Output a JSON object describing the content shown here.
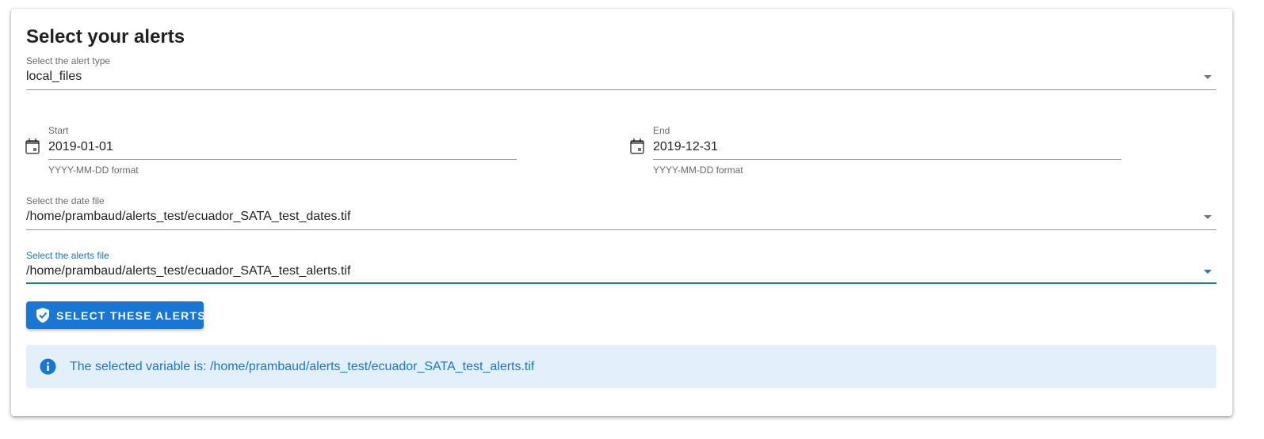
{
  "panel": {
    "title": "Select your alerts"
  },
  "alert_type": {
    "label": "Select the alert type",
    "value": "local_files"
  },
  "start_date": {
    "label": "Start",
    "value": "2019-01-01",
    "hint": "YYYY-MM-DD format",
    "icon": "calendar-icon"
  },
  "end_date": {
    "label": "End",
    "value": "2019-12-31",
    "hint": "YYYY-MM-DD format",
    "icon": "calendar-icon"
  },
  "date_file": {
    "label": "Select the date file",
    "value": "/home/prambaud/alerts_test/ecuador_SATA_test_dates.tif"
  },
  "alerts_file": {
    "label": "Select the alerts file",
    "value": "/home/prambaud/alerts_test/ecuador_SATA_test_alerts.tif"
  },
  "select_button": {
    "label": "SELECT THESE ALERTS",
    "icon": "shield-check-icon"
  },
  "info_alert": {
    "icon": "info-icon",
    "text": "The selected variable is: /home/prambaud/alerts_test/ecuador_SATA_test_alerts.tif"
  },
  "colors": {
    "primary": "#1976d2",
    "info_background": "#e3effb"
  }
}
